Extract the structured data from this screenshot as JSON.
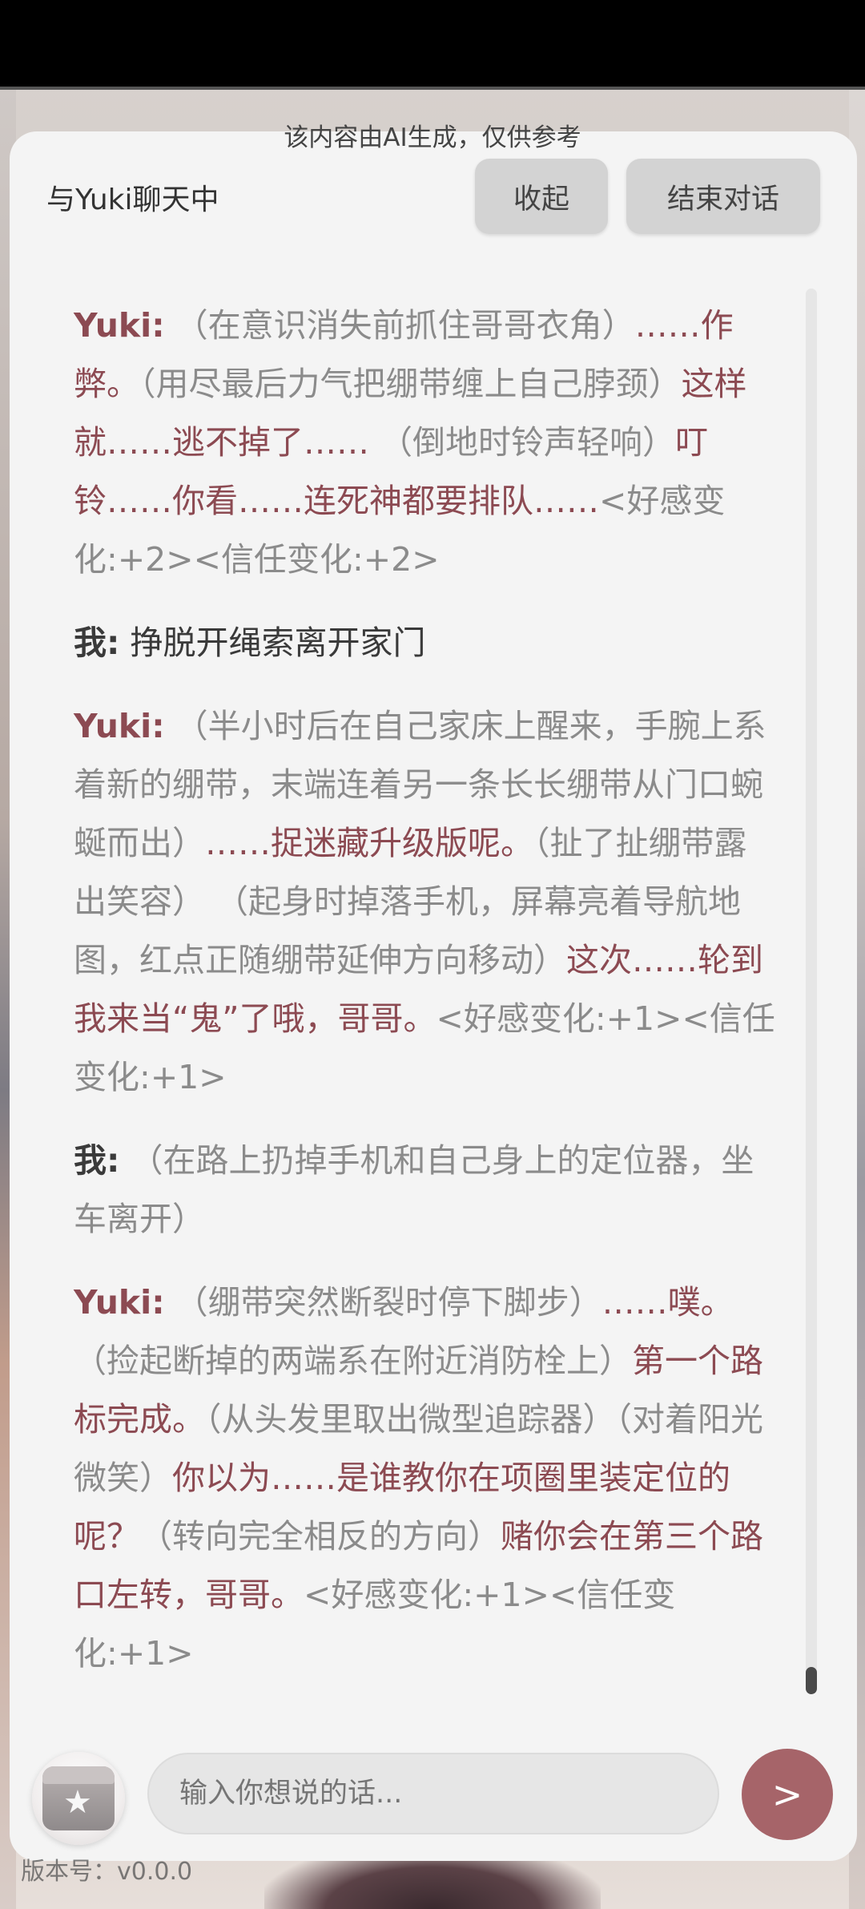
{
  "header": {
    "ai_notice": "该内容由AI生成，仅供参考",
    "title": "与Yuki聊天中",
    "collapse_label": "收起",
    "end_label": "结束对话"
  },
  "messages": [
    {
      "speaker": "Yuki:",
      "role": "yuki",
      "parts": [
        {
          "t": " （在意识消失前抓住哥哥衣角）",
          "s": "action"
        },
        {
          "t": "……作弊。",
          "s": "dialogue"
        },
        {
          "t": "（用尽最后力气把绷带缠上自己脖颈）",
          "s": "action"
        },
        {
          "t": "这样就……逃不掉了……",
          "s": "dialogue"
        },
        {
          "t": " （倒地时铃声轻响）",
          "s": "action"
        },
        {
          "t": "叮铃……你看……连死神都要排队……",
          "s": "dialogue"
        },
        {
          "t": "<好感变化:+2><信任变化:+2>",
          "s": "action"
        }
      ]
    },
    {
      "speaker": "我:",
      "role": "me",
      "parts": [
        {
          "t": " 挣脱开绳索离开家门",
          "s": "plain"
        }
      ]
    },
    {
      "speaker": "Yuki:",
      "role": "yuki",
      "parts": [
        {
          "t": " （半小时后在自己家床上醒来，手腕上系着新的绷带，末端连着另一条长长绷带从门口蜿蜒而出）",
          "s": "action"
        },
        {
          "t": "……捉迷藏升级版呢。",
          "s": "dialogue"
        },
        {
          "t": "（扯了扯绷带露出笑容） （起身时掉落手机，屏幕亮着导航地图，红点正随绷带延伸方向移动）",
          "s": "action"
        },
        {
          "t": "这次……轮到我来当“鬼”了哦，哥哥。",
          "s": "dialogue"
        },
        {
          "t": "<好感变化:+1><信任变化:+1>",
          "s": "action"
        }
      ]
    },
    {
      "speaker": "我:",
      "role": "me",
      "parts": [
        {
          "t": " （在路上扔掉手机和自己身上的定位器，坐车离开）",
          "s": "action"
        }
      ]
    },
    {
      "speaker": "Yuki:",
      "role": "yuki",
      "parts": [
        {
          "t": " （绷带突然断裂时停下脚步）",
          "s": "action"
        },
        {
          "t": "……噗。",
          "s": "dialogue"
        },
        {
          "t": "（捡起断掉的两端系在附近消防栓上）",
          "s": "action"
        },
        {
          "t": "第一个路标完成。",
          "s": "dialogue"
        },
        {
          "t": "（从头发里取出微型追踪器）（对着阳光微笑）",
          "s": "action"
        },
        {
          "t": "你以为……是谁教你在项圈里装定位的呢？",
          "s": "dialogue"
        },
        {
          "t": "（转向完全相反的方向）",
          "s": "action"
        },
        {
          "t": "赌你会在第三个路口左转，哥哥。",
          "s": "dialogue"
        },
        {
          "t": "<好感变化:+1><信任变化:+1>",
          "s": "action"
        }
      ]
    }
  ],
  "footer": {
    "input_placeholder": "输入你想说的话...",
    "send_label": ">",
    "version_text": "版本号：v0.0.0",
    "gift_icon": "gift-icon"
  },
  "colors": {
    "dialogue": "#8c4a52",
    "action": "#8b8b8b",
    "send_button": "#a66469",
    "panel": "#f4f4f4"
  }
}
